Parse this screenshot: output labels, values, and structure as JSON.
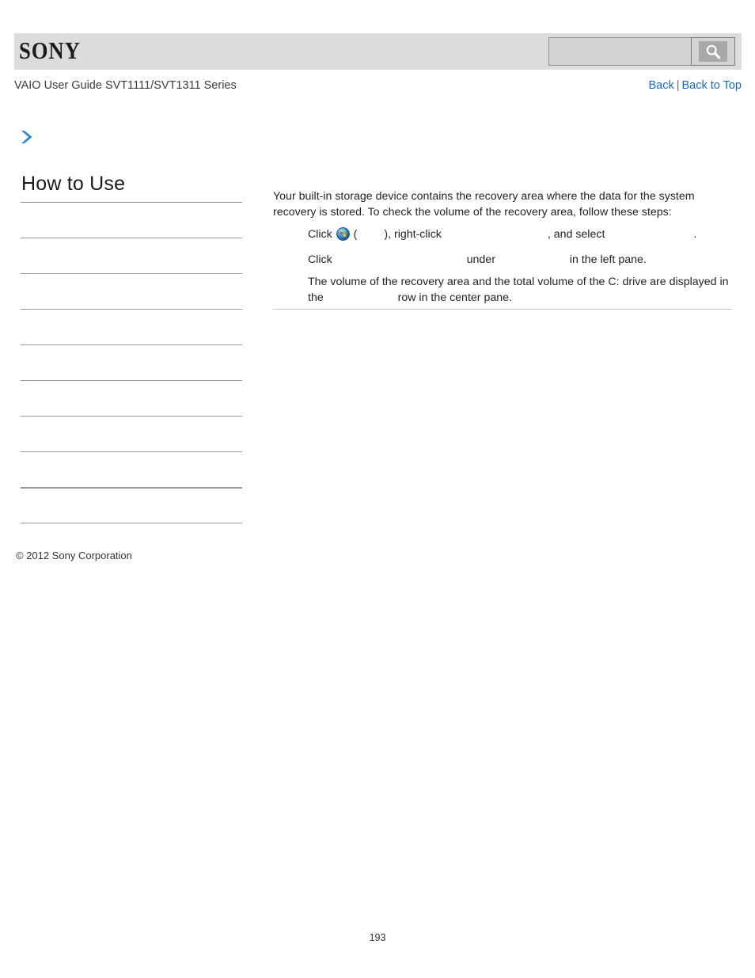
{
  "header": {
    "logo_text": "SONY",
    "search": {
      "value": "",
      "placeholder": "",
      "button_icon": "search-icon"
    }
  },
  "document": {
    "title": "VAIO User Guide SVT1111/SVT1311 Series",
    "nav": {
      "back_label": "Back",
      "separator": "|",
      "back_to_top_label": "Back to Top"
    },
    "arrow_icon": "chevron-right-icon",
    "copyright": "© 2012 Sony Corporation",
    "page_number": "193"
  },
  "sidebar": {
    "heading": "How to Use",
    "items": [
      {
        "label": ""
      },
      {
        "label": ""
      },
      {
        "label": ""
      },
      {
        "label": ""
      },
      {
        "label": ""
      },
      {
        "label": ""
      },
      {
        "label": ""
      },
      {
        "label": ""
      },
      {
        "label": ""
      },
      {
        "label": ""
      }
    ]
  },
  "content": {
    "intro": "Your built-in storage device contains the recovery area where the data for the system recovery is stored. To check the volume of the recovery area, follow these steps:",
    "steps": [
      {
        "parts": [
          {
            "type": "text",
            "value": "Click "
          },
          {
            "type": "icon",
            "value": "windows-start-orb-icon"
          },
          {
            "type": "text",
            "value": " ("
          },
          {
            "type": "blank",
            "size": "blank-xs"
          },
          {
            "type": "text",
            "value": "), right-click "
          },
          {
            "type": "blank",
            "size": "blank-lg"
          },
          {
            "type": "text",
            "value": ", and select "
          },
          {
            "type": "blank",
            "size": "blank-md"
          },
          {
            "type": "text",
            "value": "."
          }
        ]
      },
      {
        "parts": [
          {
            "type": "text",
            "value": "Click "
          },
          {
            "type": "blank",
            "size": "blank-xl"
          },
          {
            "type": "text",
            "value": " under "
          },
          {
            "type": "blank",
            "size": "blank-sm"
          },
          {
            "type": "text",
            "value": " in the left pane."
          }
        ]
      },
      {
        "parts": [
          {
            "type": "text",
            "value": "The volume of the recovery area and the total volume of the C: drive are displayed in the "
          },
          {
            "type": "blank",
            "size": "blank-sm"
          },
          {
            "type": "text",
            "value": " row in the center pane."
          }
        ]
      }
    ]
  },
  "colors": {
    "header_band": "#dcdcdc",
    "link_blue": "#1569cf",
    "arrow_blue": "#2e8bd0",
    "rule_gray": "#9a9a9a",
    "content_rule": "#cbcbcb"
  }
}
